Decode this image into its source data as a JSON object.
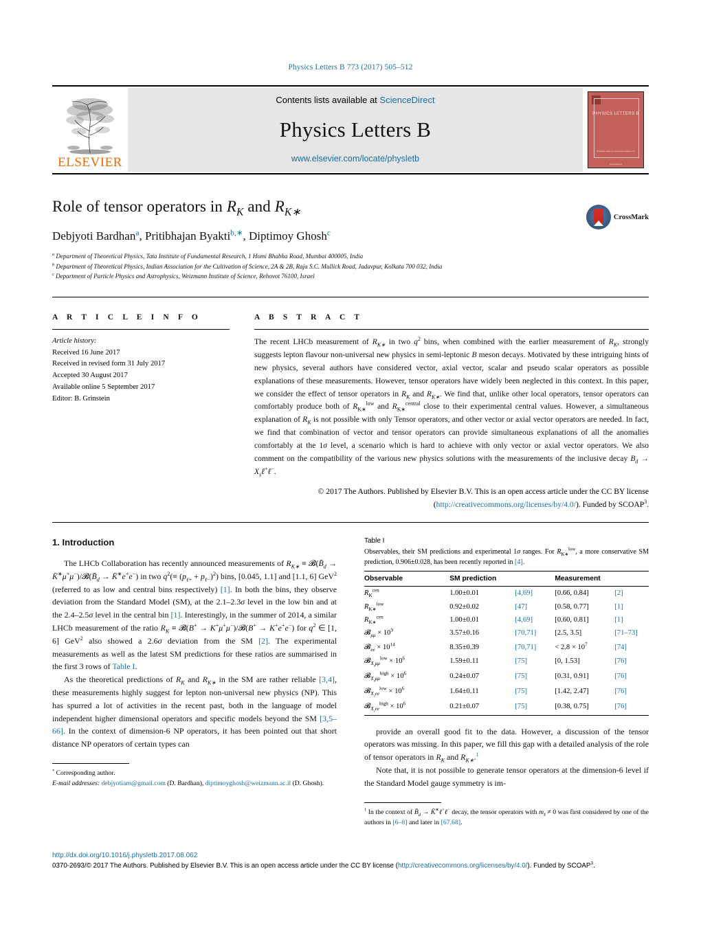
{
  "journal": {
    "citation_line": "Physics Letters B 773 (2017) 505–512",
    "contents_prefix": "Contents lists available at",
    "contents_link": "ScienceDirect",
    "name": "Physics Letters B",
    "url": "www.elsevier.com/locate/physletb",
    "publisher_wordmark": "ELSEVIER",
    "cover_title": "PHYSICS LETTERS B",
    "cover_footer_1": "Available online at www.sciencedirect.com",
    "cover_footer_2": "ScienceDirect",
    "accent_link_color": "#1a6ea8",
    "elsevier_orange": "#f06c00",
    "cover_red": "#c4605a"
  },
  "article": {
    "title_html": "Role of tensor operators in <span class=\"m\">R<sub>K</sub></span> and <span class=\"m\">R<sub>K∗</sub></span>",
    "title_plain": "Role of tensor operators in RK and RK*",
    "authors_html": "Debjyoti Bardhan<sup>a</sup>, Pritibhajan Byakti<sup>b,∗</sup>, Diptimoy Ghosh<sup>c</sup>",
    "affiliations": [
      {
        "marker": "a",
        "text": "Department of Theoretical Physics, Tata Institute of Fundamental Research, 1 Homi Bhabha Road, Mumbai 400005, India"
      },
      {
        "marker": "b",
        "text": "Department of Theoretical Physics, Indian Association for the Cultivation of Science, 2A & 2B, Raja S.C. Mullick Road, Jadavpur, Kolkata 700 032, India"
      },
      {
        "marker": "c",
        "text": "Department of Particle Physics and Astrophysics, Weizmann Institute of Science, Rehovot 76100, Israel"
      }
    ],
    "crossmark_label": "CrossMark"
  },
  "article_info": {
    "heading": "A R T I C L E  I N F O",
    "history_label": "Article history:",
    "history": [
      "Received 16 June 2017",
      "Received in revised form 31 July 2017",
      "Accepted 30 August 2017",
      "Available online 5 September 2017",
      "Editor: B. Grinstein"
    ]
  },
  "abstract": {
    "heading": "A B S T R A C T",
    "body_html": "The recent LHCb measurement of <span class=\"m\">R<sub>K∗</sub></span> in two <span class=\"m\">q</span><sup>2</sup> bins, when combined with the earlier measurement of <span class=\"m\">R<sub>K</sub></span>, strongly suggests lepton flavour non-universal new physics in semi-leptonic <span class=\"m\">B</span> meson decays. Motivated by these intriguing hints of new physics, several authors have considered vector, axial vector, scalar and pseudo scalar operators as possible explanations of these measurements. However, tensor operators have widely been neglected in this context. In this paper, we consider the effect of tensor operators in <span class=\"m\">R<sub>K</sub></span> and <span class=\"m\">R<sub>K∗</sub></span>. We find that, unlike other local operators, tensor operators can comfortably produce both of <span class=\"m\">R</span><sub class=\"up\">K∗</sub><sup class=\"up\">low</sup> and <span class=\"m\">R</span><sub class=\"up\">K∗</sub><sup class=\"up\">central</sup> close to their experimental central values. However, a simultaneous explanation of <span class=\"m\">R<sub>K</sub></span> is not possible with only Tensor operators, and other vector or axial vector operators are needed. In fact, we find that combination of vector and tensor operators can provide simultaneous explanations of all the anomalies comfortably at the 1<span class=\"m\">σ</span> level, a scenario which is hard to achieve with only vector or axial vector operators. We also comment on the compatibility of the various new physics solutions with the measurements of the inclusive decay <span class=\"m\">B<sub>d</sub></span> → <span class=\"m\">X<sub>s</sub>ℓ</span><sup>+</sup><span class=\"m\">ℓ</span><sup>−</sup>.",
    "copyright_html": "© 2017 The Authors. Published by Elsevier B.V. This is an open access article under the CC BY license (<a href=\"#\">http://creativecommons.org/licenses/by/4.0/</a>). Funded by SCOAP<sup>3</sup>."
  },
  "introduction": {
    "heading": "1. Introduction",
    "paragraph_1_html": "The LHCb Collaboration has recently announced measurements of <span class=\"m\">R<sub>K∗</sub></span> ≡ 𝓑(<span class=\"m\">B̄<sub>d</sub></span> → <span class=\"m\">K̄</span><sup>∗</sup><span class=\"m\">μ</span><sup>+</sup><span class=\"m\">μ</span><sup>−</sup>)/𝓑(<span class=\"m\">B̄<sub>d</sub></span> → <span class=\"m\">K̄</span><sup>∗</sup><span class=\"m\">e</span><sup>+</sup><span class=\"m\">e</span><sup>−</sup>) in two <span class=\"m\">q</span><sup>2</sup>(≡ (<span class=\"m\">p<sub>ℓ</sub></span><sub>+</sub> + <span class=\"m\">p<sub>ℓ</sub></span><sub>−</sub>)<sup>2</sup>) bins, [0.045, 1.1] and [1.1, 6] GeV<sup>2</sup> (referred to as low and central bins respectively) <span class=\"ref\">[1]</span>. In both the bins, they observe deviation from the Standard Model (SM), at the 2.1–2.3<span class=\"m\">σ</span> level in the low bin and at the 2.4–2.5<span class=\"m\">σ</span> level in the central bin <span class=\"ref\">[1]</span>. Interestingly, in the summer of 2014, a similar LHCb measurement of the ratio <span class=\"m\">R<sub>K</sub></span> ≡ 𝓑(<span class=\"m\">B</span><sup>+</sup> → <span class=\"m\">K</span><sup>+</sup><span class=\"m\">μ</span><sup>+</sup><span class=\"m\">μ</span><sup>−</sup>)/𝓑(<span class=\"m\">B</span><sup>+</sup> → <span class=\"m\">K</span><sup>+</sup><span class=\"m\">e</span><sup>+</sup><span class=\"m\">e</span><sup>−</sup>) for <span class=\"m\">q</span><sup>2</sup> ∈ [1, 6] GeV<sup>2</sup> also showed a 2.6<span class=\"m\">σ</span> deviation from the SM <span class=\"ref\">[2]</span>. The experimental measurements as well as the latest SM predictions for these ratios are summarised in the first 3 rows of <span class=\"ref\">Table I</span>.",
    "paragraph_2_html": "As the theoretical predictions of <span class=\"m\">R<sub>K</sub></span> and <span class=\"m\">R<sub>K∗</sub></span> in the SM are rather reliable <span class=\"ref\">[3,4]</span>, these measurements highly suggest for lepton non-universal new physics (NP). This has spurred a lot of activities in the recent past, both in the language of model independent higher dimensional operators and specific models beyond the SM <span class=\"ref\">[3,5–66]</span>. In the context of dimension-6 NP operators, it has been pointed out that short distance NP operators of certain types can",
    "paragraph_3_html": "provide an overall good fit to the data. However, a discussion of the tensor operators was missing. In this paper, we fill this gap with a detailed analysis of the role of tensor operators in <span class=\"m\">R<sub>K</sub></span> and <span class=\"m\">R<sub>K∗</sub></span>.<sup class=\"ref\">1</sup>",
    "paragraph_4_html": "Note that, it is not possible to generate tensor operators at the dimension-6 level if the Standard Model gauge symmetry is im-"
  },
  "table": {
    "label": "Table I",
    "caption_html": "Observables, their SM predictions and experimental 1<span class=\"m\">σ</span> ranges. For <span class=\"m\">R</span><sub class=\"up\">K∗</sub><sup class=\"up\">low</sup>, a more conservative SM prediction, 0.906±0.028, has been recently reported in <a href=\"#\">[4]</a>.",
    "columns": [
      "Observable",
      "SM prediction",
      "",
      "Measurement",
      ""
    ],
    "rows": [
      {
        "observable_html": "<span class=\"m\">R</span><sub class=\"up\">K</sub><sup class=\"up\">cen</sup>",
        "sm": "1.00±0.01",
        "sm_ref": "[4,69]",
        "meas": "[0.66, 0.84]",
        "meas_ref": "[2]"
      },
      {
        "observable_html": "<span class=\"m\">R</span><sub class=\"up\">K∗</sub><sup class=\"up\">low</sup>",
        "sm": "0.92±0.02",
        "sm_ref": "[47]",
        "meas": "[0.58, 0.77]",
        "meas_ref": "[1]"
      },
      {
        "observable_html": "<span class=\"m\">R</span><sub class=\"up\">K∗</sub><sup class=\"up\">cen</sup>",
        "sm": "1.00±0.01",
        "sm_ref": "[4,69]",
        "meas": "[0.60, 0.81]",
        "meas_ref": "[1]"
      },
      {
        "observable_html": "𝓑<sub class=\"m\">μμ</sub> × 10<sup>9</sup>",
        "sm": "3.57±0.16",
        "sm_ref": "[70,71]",
        "meas": "[2.5, 3.5]",
        "meas_ref": "[71–73]"
      },
      {
        "observable_html": "𝓑<sub class=\"m\">ee</sub> × 10<sup>14</sup>",
        "sm": "8.35±0.39",
        "sm_ref": "[70,71]",
        "meas": "< 2.8 × 10<sup>7</sup>",
        "meas_ref": "[74]"
      },
      {
        "observable_html": "𝓑<sub class=\"m\">X<sub>s</sub>μμ</sub><sup class=\"up\">low</sup> × 10<sup>6</sup>",
        "sm": "1.59±0.11",
        "sm_ref": "[75]",
        "meas": "[0, 1.53]",
        "meas_ref": "[76]"
      },
      {
        "observable_html": "𝓑<sub class=\"m\">X<sub>s</sub>μμ</sub><sup class=\"up\">high</sup> × 10<sup>6</sup>",
        "sm": "0.24±0.07",
        "sm_ref": "[75]",
        "meas": "[0.31, 0.91]",
        "meas_ref": "[76]"
      },
      {
        "observable_html": "𝓑<sub class=\"m\">X<sub>s</sub>ee</sub><sup class=\"up\">low</sup> × 10<sup>6</sup>",
        "sm": "1.64±0.11",
        "sm_ref": "[75]",
        "meas": "[1.42, 2.47]",
        "meas_ref": "[76]"
      },
      {
        "observable_html": "𝓑<sub class=\"m\">X<sub>s</sub>ee</sub><sup class=\"up\">high</sup> × 10<sup>6</sup>",
        "sm": "0.21±0.07",
        "sm_ref": "[75]",
        "meas": "[0.38, 0.75]",
        "meas_ref": "[76]"
      }
    ]
  },
  "footnotes": {
    "corresponding_marker": "*",
    "corresponding_text": "Corresponding author.",
    "email_label": "E-mail addresses:",
    "emails_html": "<a href=\"#\">debjyotiarn@gmail.com</a> (D. Bardhan), <a href=\"#\">diptimoyghosh@weizmann.ac.il</a> (D. Ghosh).",
    "right_note_html": "<sup>1</sup> In the context of <span class=\"m\">B̄<sub>d</sub></span> → <span class=\"m\">K̄</span><sup>∗</sup><span class=\"m\">ℓ</span><sup>+</sup><span class=\"m\">ℓ</span><sup>−</sup> decay, the tensor operators with <span class=\"m\">m<sub>ℓ</sub></span> ≠ 0 was first considered by one of the authors in <a href=\"#\">[6–8]</a> and later in <a href=\"#\">[67,68]</a>."
  },
  "page_footer": {
    "doi": "http://dx.doi.org/10.1016/j.physletb.2017.08.062",
    "issn_html": "0370-2693/© 2017 The Authors. Published by Elsevier B.V. This is an open access article under the CC BY license (<a href=\"#\">http://creativecommons.org/licenses/by/4.0/</a>). Funded by SCOAP<sup>3</sup>."
  }
}
